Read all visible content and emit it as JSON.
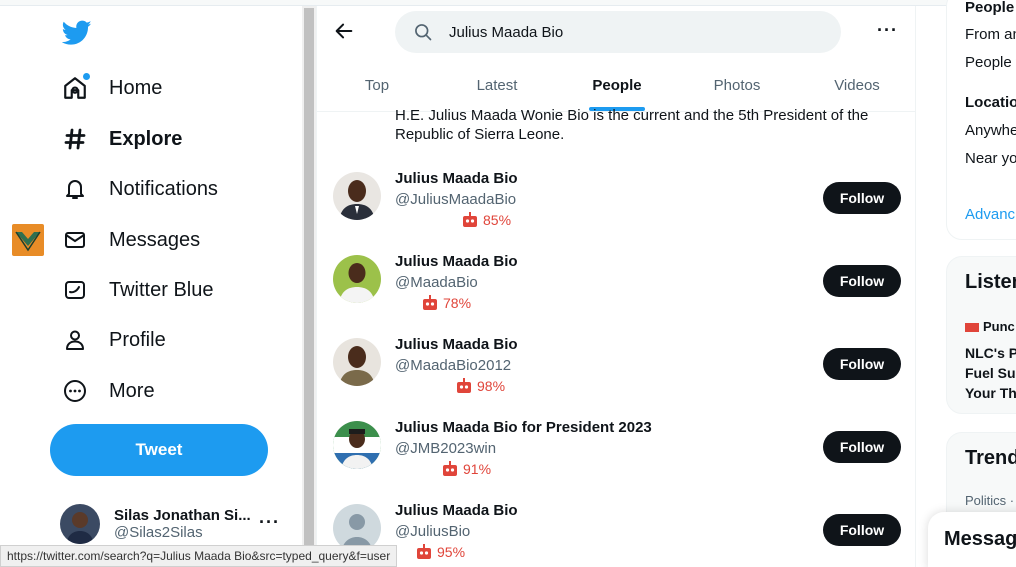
{
  "sidebar": {
    "nav": [
      {
        "label": "Home",
        "icon": "home-icon"
      },
      {
        "label": "Explore",
        "icon": "hashtag-icon"
      },
      {
        "label": "Notifications",
        "icon": "bell-icon"
      },
      {
        "label": "Messages",
        "icon": "envelope-icon"
      },
      {
        "label": "Twitter Blue",
        "icon": "twitter-blue-icon"
      },
      {
        "label": "Profile",
        "icon": "person-icon"
      },
      {
        "label": "More",
        "icon": "more-circle-icon"
      }
    ],
    "tweet_label": "Tweet",
    "account": {
      "name": "Silas Jonathan Si...",
      "handle": "@Silas2Silas"
    }
  },
  "search": {
    "value": "Julius Maada Bio"
  },
  "tabs": [
    {
      "label": "Top",
      "active": false
    },
    {
      "label": "Latest",
      "active": false
    },
    {
      "label": "People",
      "active": true
    },
    {
      "label": "Photos",
      "active": false
    },
    {
      "label": "Videos",
      "active": false
    }
  ],
  "bio_snippet": "H.E. Julius Maada Wonie Bio is the current and the 5th President of the Republic of Sierra Leone.",
  "people": [
    {
      "name": "Julius Maada Bio",
      "handle": "@JuliusMaadaBio",
      "score": "85%",
      "follow": "Follow"
    },
    {
      "name": "Julius Maada Bio",
      "handle": "@MaadaBio",
      "score": "78%",
      "follow": "Follow"
    },
    {
      "name": "Julius Maada Bio",
      "handle": "@MaadaBio2012",
      "score": "98%",
      "follow": "Follow"
    },
    {
      "name": "Julius Maada Bio for President 2023",
      "handle": "@JMB2023win",
      "score": "91%",
      "follow": "Follow"
    },
    {
      "name": "Julius Maada Bio",
      "handle": "@JuliusBio",
      "score": "95%",
      "follow": "Follow"
    }
  ],
  "right": {
    "people_title": "People",
    "from_any": "From an",
    "people_you": "People y",
    "location_title": "Locatio",
    "anywhere": "Anywhe",
    "near_you": "Near yo",
    "advanced": "Advanc",
    "listen_title": "Listen",
    "punch_label": "Punc",
    "headline": [
      "NLC's P",
      "Fuel Su",
      "Your Th"
    ],
    "trends_title": "Trend",
    "politics": "Politics ·"
  },
  "messages_drawer": "Messag",
  "status_url": "https://twitter.com/search?q=Julius Maada Bio&src=typed_query&f=user",
  "colors": {
    "accent": "#1d9bf0",
    "score_red": "#e0453a",
    "ext_orange": "#e88c27"
  }
}
